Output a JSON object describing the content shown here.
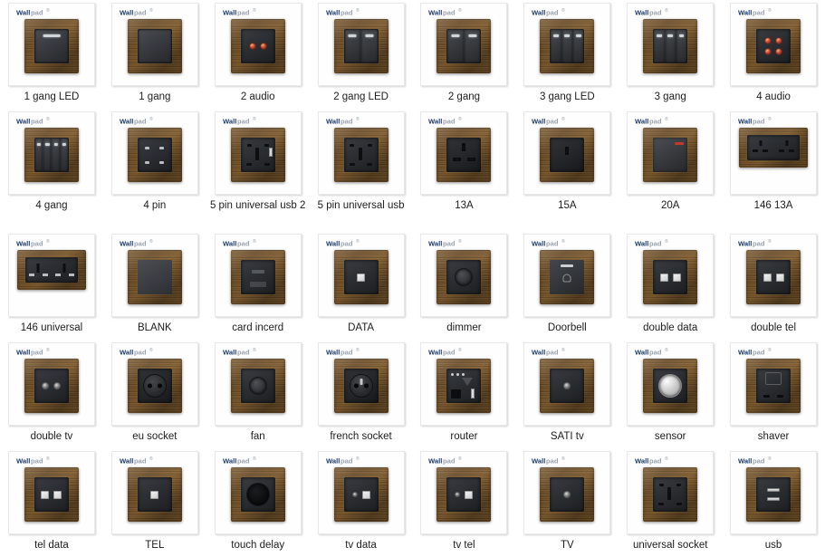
{
  "page": {
    "title": "Wallpad wood-frame switches and sockets product grid",
    "brand": "Wallpad",
    "columns": 8,
    "rows": 5,
    "total_items": 40,
    "background_color": "#ffffff",
    "card_color": "#fefefe",
    "caption_color": "#1c1c1c",
    "wood_color": "#6b4a22",
    "module_color": "#2b2e32"
  },
  "items": [
    {
      "label": "1 gang LED",
      "face": "rockers",
      "gangs": 1,
      "led": true
    },
    {
      "label": "1 gang",
      "face": "rockers",
      "gangs": 1,
      "led": false
    },
    {
      "label": "2 audio",
      "face": "audio2",
      "gangs": 0,
      "led": false
    },
    {
      "label": "2 gang LED",
      "face": "rockers",
      "gangs": 2,
      "led": true
    },
    {
      "label": "2 gang",
      "face": "rockers",
      "gangs": 2,
      "led": true
    },
    {
      "label": "3 gang LED",
      "face": "rockers",
      "gangs": 3,
      "led": true
    },
    {
      "label": "3 gang",
      "face": "rockers",
      "gangs": 3,
      "led": true
    },
    {
      "label": "4 audio",
      "face": "audio4",
      "gangs": 0,
      "led": false
    },
    {
      "label": "4 gang",
      "face": "rockers",
      "gangs": 4,
      "led": true
    },
    {
      "label": "4 pin",
      "face": "fourpin",
      "gangs": 0,
      "led": false
    },
    {
      "label": "5 pin universal usb 2",
      "face": "universal_usb",
      "gangs": 0,
      "led": false
    },
    {
      "label": "5 pin universal usb",
      "face": "universal",
      "gangs": 0,
      "led": false
    },
    {
      "label": "13A",
      "face": "uk13",
      "gangs": 0,
      "led": false
    },
    {
      "label": "15A",
      "face": "uk15",
      "gangs": 0,
      "led": false
    },
    {
      "label": "20A",
      "face": "bigrock",
      "gangs": 0,
      "led": true
    },
    {
      "label": "146 13A",
      "face": "twin13",
      "gangs": 0,
      "led": false,
      "wide": true
    },
    {
      "label": "146 universal",
      "face": "twinuni",
      "gangs": 0,
      "led": false,
      "wide": true
    },
    {
      "label": "BLANK",
      "face": "blank",
      "gangs": 0,
      "led": false
    },
    {
      "label": "card incerd",
      "face": "cardins",
      "gangs": 0,
      "led": false
    },
    {
      "label": "DATA",
      "face": "data1",
      "gangs": 0,
      "led": false
    },
    {
      "label": "dimmer",
      "face": "dimmer",
      "gangs": 0,
      "led": false
    },
    {
      "label": "Doorbell",
      "face": "doorbell",
      "gangs": 0,
      "led": true
    },
    {
      "label": "double data",
      "face": "data2",
      "gangs": 0,
      "led": false
    },
    {
      "label": "double tel",
      "face": "data2",
      "gangs": 0,
      "led": false
    },
    {
      "label": "double tv",
      "face": "tv2",
      "gangs": 0,
      "led": false
    },
    {
      "label": "eu socket",
      "face": "eu",
      "gangs": 0,
      "led": false
    },
    {
      "label": "fan",
      "face": "fan",
      "gangs": 0,
      "led": false
    },
    {
      "label": "french socket",
      "face": "french",
      "gangs": 0,
      "led": false
    },
    {
      "label": "router",
      "face": "router",
      "gangs": 0,
      "led": false
    },
    {
      "label": "SATI tv",
      "face": "tv1",
      "gangs": 0,
      "led": false
    },
    {
      "label": "sensor",
      "face": "sensor",
      "gangs": 0,
      "led": false
    },
    {
      "label": "shaver",
      "face": "shaver",
      "gangs": 0,
      "led": false
    },
    {
      "label": "tel data",
      "face": "data2",
      "gangs": 0,
      "led": false
    },
    {
      "label": "TEL",
      "face": "data1",
      "gangs": 0,
      "led": false
    },
    {
      "label": "touch delay",
      "face": "touch",
      "gangs": 0,
      "led": false
    },
    {
      "label": "tv data",
      "face": "tvdata",
      "gangs": 0,
      "led": false
    },
    {
      "label": "tv tel",
      "face": "tvdata",
      "gangs": 0,
      "led": false
    },
    {
      "label": "TV",
      "face": "tv1",
      "gangs": 0,
      "led": false
    },
    {
      "label": "universal socket",
      "face": "universal",
      "gangs": 0,
      "led": false
    },
    {
      "label": "usb",
      "face": "usb2",
      "gangs": 0,
      "led": false
    }
  ]
}
